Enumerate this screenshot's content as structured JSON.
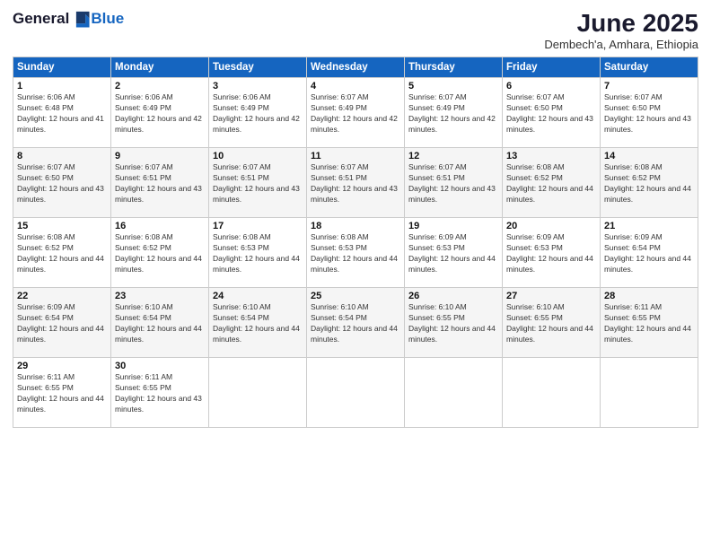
{
  "logo": {
    "general": "General",
    "blue": "Blue"
  },
  "title": "June 2025",
  "subtitle": "Dembech'a, Amhara, Ethiopia",
  "headers": [
    "Sunday",
    "Monday",
    "Tuesday",
    "Wednesday",
    "Thursday",
    "Friday",
    "Saturday"
  ],
  "weeks": [
    [
      {
        "day": "1",
        "sunrise": "6:06 AM",
        "sunset": "6:48 PM",
        "daylight": "12 hours and 41 minutes."
      },
      {
        "day": "2",
        "sunrise": "6:06 AM",
        "sunset": "6:49 PM",
        "daylight": "12 hours and 42 minutes."
      },
      {
        "day": "3",
        "sunrise": "6:06 AM",
        "sunset": "6:49 PM",
        "daylight": "12 hours and 42 minutes."
      },
      {
        "day": "4",
        "sunrise": "6:07 AM",
        "sunset": "6:49 PM",
        "daylight": "12 hours and 42 minutes."
      },
      {
        "day": "5",
        "sunrise": "6:07 AM",
        "sunset": "6:49 PM",
        "daylight": "12 hours and 42 minutes."
      },
      {
        "day": "6",
        "sunrise": "6:07 AM",
        "sunset": "6:50 PM",
        "daylight": "12 hours and 43 minutes."
      },
      {
        "day": "7",
        "sunrise": "6:07 AM",
        "sunset": "6:50 PM",
        "daylight": "12 hours and 43 minutes."
      }
    ],
    [
      {
        "day": "8",
        "sunrise": "6:07 AM",
        "sunset": "6:50 PM",
        "daylight": "12 hours and 43 minutes."
      },
      {
        "day": "9",
        "sunrise": "6:07 AM",
        "sunset": "6:51 PM",
        "daylight": "12 hours and 43 minutes."
      },
      {
        "day": "10",
        "sunrise": "6:07 AM",
        "sunset": "6:51 PM",
        "daylight": "12 hours and 43 minutes."
      },
      {
        "day": "11",
        "sunrise": "6:07 AM",
        "sunset": "6:51 PM",
        "daylight": "12 hours and 43 minutes."
      },
      {
        "day": "12",
        "sunrise": "6:07 AM",
        "sunset": "6:51 PM",
        "daylight": "12 hours and 43 minutes."
      },
      {
        "day": "13",
        "sunrise": "6:08 AM",
        "sunset": "6:52 PM",
        "daylight": "12 hours and 44 minutes."
      },
      {
        "day": "14",
        "sunrise": "6:08 AM",
        "sunset": "6:52 PM",
        "daylight": "12 hours and 44 minutes."
      }
    ],
    [
      {
        "day": "15",
        "sunrise": "6:08 AM",
        "sunset": "6:52 PM",
        "daylight": "12 hours and 44 minutes."
      },
      {
        "day": "16",
        "sunrise": "6:08 AM",
        "sunset": "6:52 PM",
        "daylight": "12 hours and 44 minutes."
      },
      {
        "day": "17",
        "sunrise": "6:08 AM",
        "sunset": "6:53 PM",
        "daylight": "12 hours and 44 minutes."
      },
      {
        "day": "18",
        "sunrise": "6:08 AM",
        "sunset": "6:53 PM",
        "daylight": "12 hours and 44 minutes."
      },
      {
        "day": "19",
        "sunrise": "6:09 AM",
        "sunset": "6:53 PM",
        "daylight": "12 hours and 44 minutes."
      },
      {
        "day": "20",
        "sunrise": "6:09 AM",
        "sunset": "6:53 PM",
        "daylight": "12 hours and 44 minutes."
      },
      {
        "day": "21",
        "sunrise": "6:09 AM",
        "sunset": "6:54 PM",
        "daylight": "12 hours and 44 minutes."
      }
    ],
    [
      {
        "day": "22",
        "sunrise": "6:09 AM",
        "sunset": "6:54 PM",
        "daylight": "12 hours and 44 minutes."
      },
      {
        "day": "23",
        "sunrise": "6:10 AM",
        "sunset": "6:54 PM",
        "daylight": "12 hours and 44 minutes."
      },
      {
        "day": "24",
        "sunrise": "6:10 AM",
        "sunset": "6:54 PM",
        "daylight": "12 hours and 44 minutes."
      },
      {
        "day": "25",
        "sunrise": "6:10 AM",
        "sunset": "6:54 PM",
        "daylight": "12 hours and 44 minutes."
      },
      {
        "day": "26",
        "sunrise": "6:10 AM",
        "sunset": "6:55 PM",
        "daylight": "12 hours and 44 minutes."
      },
      {
        "day": "27",
        "sunrise": "6:10 AM",
        "sunset": "6:55 PM",
        "daylight": "12 hours and 44 minutes."
      },
      {
        "day": "28",
        "sunrise": "6:11 AM",
        "sunset": "6:55 PM",
        "daylight": "12 hours and 44 minutes."
      }
    ],
    [
      {
        "day": "29",
        "sunrise": "6:11 AM",
        "sunset": "6:55 PM",
        "daylight": "12 hours and 44 minutes."
      },
      {
        "day": "30",
        "sunrise": "6:11 AM",
        "sunset": "6:55 PM",
        "daylight": "12 hours and 43 minutes."
      },
      null,
      null,
      null,
      null,
      null
    ]
  ]
}
